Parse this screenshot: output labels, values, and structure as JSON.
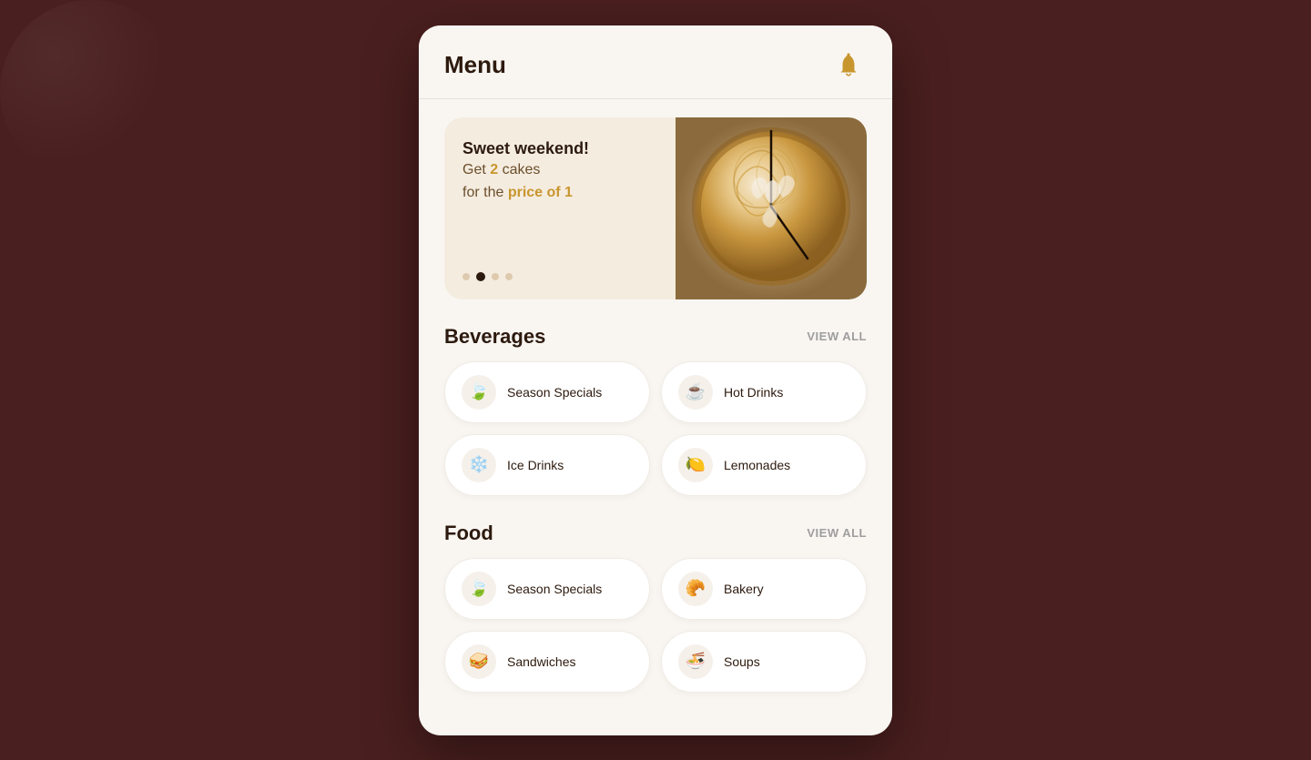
{
  "header": {
    "title": "Menu",
    "bell_icon": "🔔"
  },
  "banner": {
    "headline": "Sweet weekend!",
    "promo_line1": "Get ",
    "promo_highlight": "2",
    "promo_line1_end": " cakes",
    "promo_line2_start": "for the ",
    "promo_line2_highlight": "price of 1",
    "dots": [
      false,
      true,
      false,
      false
    ]
  },
  "sections": [
    {
      "id": "beverages",
      "title": "Beverages",
      "view_all_label": "VIEW ALL",
      "items": [
        {
          "id": "season-specials-bev",
          "label": "Season Specials",
          "icon": "🍃"
        },
        {
          "id": "hot-drinks",
          "label": "Hot Drinks",
          "icon": "☕"
        },
        {
          "id": "ice-drinks",
          "label": "Ice Drinks",
          "icon": "❄️"
        },
        {
          "id": "lemonades",
          "label": "Lemonades",
          "icon": "🍋"
        }
      ]
    },
    {
      "id": "food",
      "title": "Food",
      "view_all_label": "VIEW ALL",
      "items": [
        {
          "id": "season-specials-food",
          "label": "Season Specials",
          "icon": "🍃"
        },
        {
          "id": "bakery",
          "label": "Bakery",
          "icon": "🥐"
        },
        {
          "id": "sandwiches",
          "label": "Sandwiches",
          "icon": "🥪"
        },
        {
          "id": "soups",
          "label": "Soups",
          "icon": "🍜"
        }
      ]
    }
  ]
}
